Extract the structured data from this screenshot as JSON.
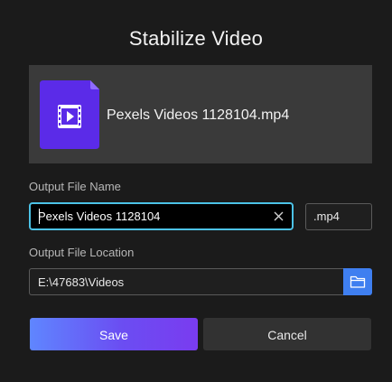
{
  "dialog": {
    "title": "Stabilize Video"
  },
  "file": {
    "name": "Pexels Videos 1128104.mp4",
    "icon": "video-file-icon"
  },
  "output_name": {
    "label": "Output File Name",
    "value": "Pexels Videos 1128104",
    "extension": ".mp4",
    "clear_icon": "close-icon"
  },
  "output_location": {
    "label": "Output File Location",
    "value": "E:\\47683\\Videos",
    "browse_icon": "folder-icon"
  },
  "actions": {
    "save_label": "Save",
    "cancel_label": "Cancel"
  },
  "colors": {
    "background": "#1b1b1b",
    "card": "#3a3a3a",
    "accent": "#4cc2e6",
    "browse_button": "#3f7ff0",
    "save_gradient_start": "#5f86ff",
    "save_gradient_end": "#7a3cf0",
    "file_icon": "#5b2be8"
  }
}
